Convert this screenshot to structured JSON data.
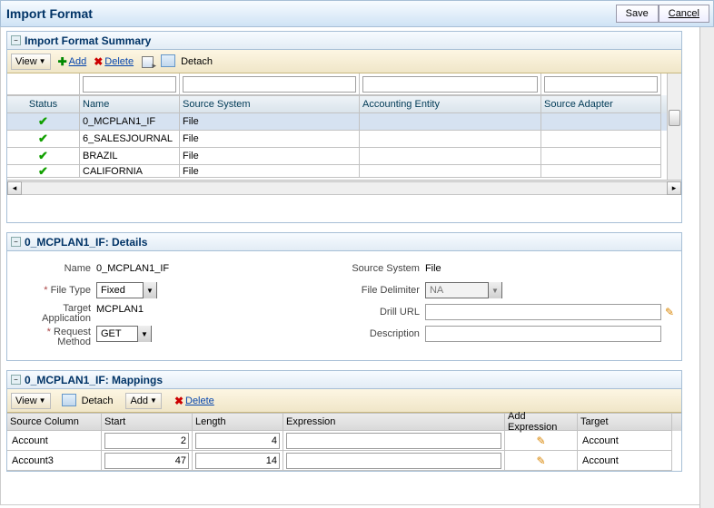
{
  "title": "Import Format",
  "top_buttons": {
    "save": "Save",
    "cancel": "Cancel"
  },
  "summary_panel": {
    "title": "Import Format Summary",
    "toolbar": {
      "view": "View",
      "add": "Add",
      "delete": "Delete",
      "detach": "Detach"
    },
    "columns": {
      "status": "Status",
      "name": "Name",
      "ssys": "Source System",
      "acc": "Accounting Entity",
      "adapter": "Source Adapter"
    },
    "rows": [
      {
        "status": "ok",
        "name": "0_MCPLAN1_IF",
        "ssys": "File",
        "acc": "",
        "adapter": ""
      },
      {
        "status": "ok",
        "name": "6_SALESJOURNAL",
        "ssys": "File",
        "acc": "",
        "adapter": ""
      },
      {
        "status": "ok",
        "name": "BRAZIL",
        "ssys": "File",
        "acc": "",
        "adapter": ""
      },
      {
        "status": "ok",
        "name": "CALIFORNIA",
        "ssys": "File",
        "acc": "",
        "adapter": ""
      }
    ]
  },
  "details_panel": {
    "title": "0_MCPLAN1_IF: Details",
    "labels": {
      "name": "Name",
      "file_type": "File Type",
      "target_app": "Target Application",
      "request_method": "Request Method",
      "source_system": "Source System",
      "file_delimiter": "File Delimiter",
      "drill_url": "Drill URL",
      "description": "Description"
    },
    "values": {
      "name": "0_MCPLAN1_IF",
      "file_type": "Fixed",
      "target_app": "MCPLAN1",
      "request_method": "GET",
      "source_system": "File",
      "file_delimiter": "NA",
      "drill_url": "",
      "description": ""
    }
  },
  "mappings_panel": {
    "title": "0_MCPLAN1_IF: Mappings",
    "toolbar": {
      "view": "View",
      "detach": "Detach",
      "add": "Add",
      "delete": "Delete"
    },
    "columns": {
      "sc": "Source Column",
      "start": "Start",
      "len": "Length",
      "expr": "Expression",
      "addexpr": "Add Expression",
      "target": "Target"
    },
    "rows": [
      {
        "sc": "Account",
        "start": "2",
        "len": "4",
        "expr": "",
        "target": "Account"
      },
      {
        "sc": "Account3",
        "start": "47",
        "len": "14",
        "expr": "",
        "target": "Account"
      }
    ]
  }
}
